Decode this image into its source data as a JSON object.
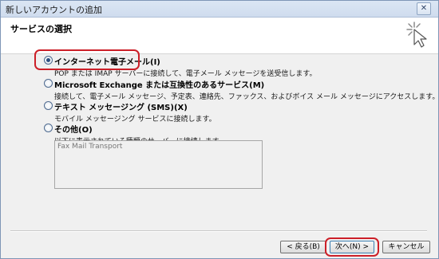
{
  "window": {
    "title": "新しいアカウントの追加",
    "close_label": "✕"
  },
  "header": {
    "title": "サービスの選択"
  },
  "options": [
    {
      "label": "インターネット電子メール(I)",
      "desc": "POP または IMAP サーバーに接続して、電子メール メッセージを送受信します。",
      "selected": true
    },
    {
      "label": "Microsoft Exchange または互換性のあるサービス(M)",
      "desc": "接続して、電子メール メッセージ、予定表、連絡先、ファックス、およびボイス メール メッセージにアクセスします。",
      "selected": false
    },
    {
      "label": "テキスト メッセージング (SMS)(X)",
      "desc": "モバイル メッセージング サービスに接続します。",
      "selected": false
    },
    {
      "label": "その他(O)",
      "desc": "以下に表示されている種類のサーバーに接続します。",
      "selected": false
    }
  ],
  "server_list": {
    "items": [
      "Fax Mail Transport"
    ]
  },
  "buttons": {
    "back": "< 戻る(B)",
    "next": "次へ(N) >",
    "cancel": "キャンセル"
  },
  "colors": {
    "highlight": "#cc1f28",
    "titlebar": "#dbe6f4"
  }
}
